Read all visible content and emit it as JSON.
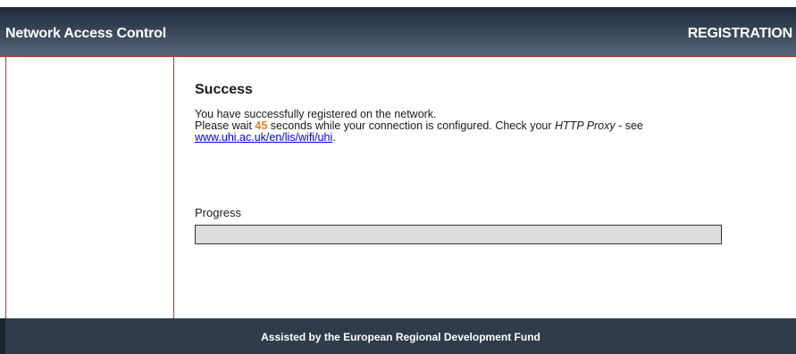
{
  "header": {
    "title": "Network Access Control",
    "section": "REGISTRATION"
  },
  "main": {
    "heading": "Success",
    "line1": "You have successfully registered on the network.",
    "line2_prefix": "Please wait ",
    "seconds": "45",
    "line2_middle": " seconds while your connection is configured. Check your ",
    "proxy_term": "HTTP Proxy",
    "line2_suffix": " - see",
    "link_text": "www.uhi.ac.uk/en/lis/wifi/uhi",
    "link_after": ".",
    "progress_label": "Progress",
    "progress_fraction": 0
  },
  "footer": {
    "text": "Assisted by the European Regional Development Fund"
  },
  "colors": {
    "accent_border": "#c0392b",
    "countdown": "#e67e22",
    "link": "#0000ee",
    "header_bg": "#2f3f50"
  }
}
